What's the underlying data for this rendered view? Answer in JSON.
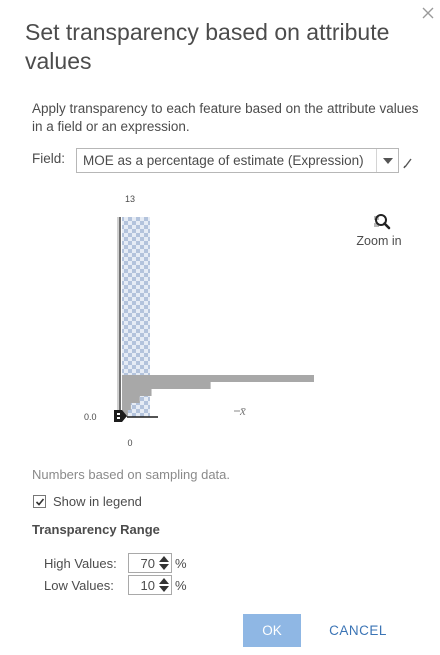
{
  "dialog": {
    "title": "Set transparency based on attribute values",
    "close_icon": "close-icon",
    "description": "Apply transparency to each feature based on the attribute values in a field or an expression.",
    "field": {
      "label": "Field:",
      "selected": "MOE as a percentage of estimate (Expression)",
      "edit_icon": "pencil-icon"
    },
    "zoom": {
      "label": "Zoom in",
      "icon": "magnifier-icon"
    },
    "note": "Numbers based on sampling data.",
    "legend": {
      "label": "Show in legend",
      "checked": true
    },
    "range": {
      "title": "Transparency Range",
      "high_label": "High Values:",
      "high_value": "70",
      "low_label": "Low Values:",
      "low_value": "10",
      "unit": "%"
    },
    "buttons": {
      "ok": "OK",
      "cancel": "CANCEL"
    },
    "colors": {
      "accent": "#8fb7e4",
      "link": "#3b74b5",
      "text": "#4c4c4c",
      "histogram": "#a8a8a8",
      "ramp_check": "#b3c3dc"
    }
  },
  "chart_data": {
    "type": "bar",
    "ylabels": {
      "top": "13",
      "handle": "0.0",
      "bottom": "0"
    },
    "mean_label": "x̄",
    "ylim": [
      0,
      13
    ],
    "histogram": [
      {
        "value": 0.93,
        "length": 0.325
      },
      {
        "value": 0.82,
        "length": 0.15
      },
      {
        "value": 0.72,
        "length": 0.05
      },
      {
        "value": 0.62,
        "length": 0.03
      },
      {
        "value": 0.47,
        "length": 0.015
      },
      {
        "value": 0.25,
        "length": 0.01
      }
    ],
    "transparency_ramp": {
      "from": 0,
      "to": 13
    },
    "grid": false
  }
}
